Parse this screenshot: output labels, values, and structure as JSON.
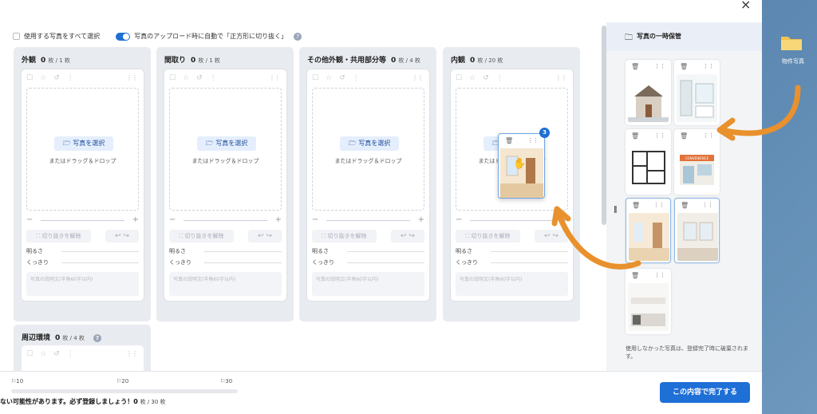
{
  "window": {
    "close_label": "×"
  },
  "topbar": {
    "select_all_label": "使用する写真をすべて選択",
    "auto_crop_label": "写真のアップロード時に自動で「正方形に切り抜く」",
    "help_label": "?"
  },
  "common": {
    "select_photo": "写真を選択",
    "or_drag": "またはドラッグ＆ドロップ",
    "crop_release": "切り抜きを解除",
    "brightness": "明るさ",
    "sharpness": "くっきり",
    "desc_placeholder": "写真の説明文(半角60字以内)",
    "zoom_minus": "−",
    "zoom_plus": "+",
    "undo_redo": "↩ ↪",
    "unit": "枚"
  },
  "columns": [
    {
      "title": "外観",
      "count": "0",
      "range": "枚 / 1 枚"
    },
    {
      "title": "間取り",
      "count": "0",
      "range": "枚 / 1 枚"
    },
    {
      "title": "その他外観・共用部分等",
      "count": "0",
      "range": "枚 / 4 枚"
    },
    {
      "title": "内観",
      "count": "0",
      "range": "枚 / 20 枚"
    },
    {
      "title": "周辺環境",
      "count": "0",
      "range": "枚 / 4 枚"
    }
  ],
  "drag_preview": {
    "badge": "3"
  },
  "temp_panel": {
    "title": "写真の一時保管",
    "note": "使用しなかった写真は、登録完了時に破棄されます。",
    "thumbnails": [
      {
        "kind": "house-exterior"
      },
      {
        "kind": "bathroom"
      },
      {
        "kind": "floor-plan"
      },
      {
        "kind": "convenience-store",
        "sign": "CONVENIENCE"
      },
      {
        "kind": "interior-room"
      },
      {
        "kind": "living-room"
      },
      {
        "kind": "kitchen"
      }
    ]
  },
  "footer": {
    "milestones": [
      "10",
      "20",
      "30"
    ],
    "progress_fraction": 0,
    "warning": "ない可能性があります。必ず登録しましょう！",
    "current_count": "0",
    "count_suffix": "枚 / 30 枚",
    "complete_button": "この内容で完了する"
  },
  "desktop": {
    "folder_label": "物件写真"
  },
  "colors": {
    "accent": "#1e6fd6",
    "arrow": "#e8912d"
  }
}
